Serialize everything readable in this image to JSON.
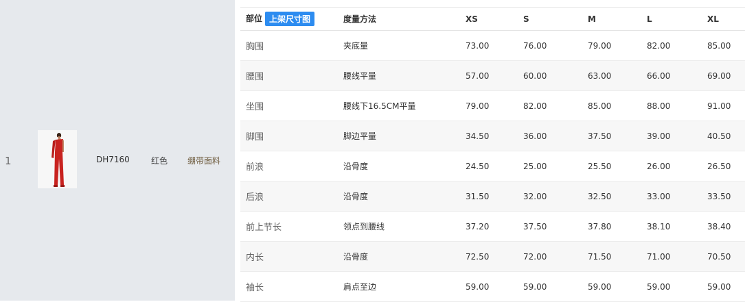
{
  "product": {
    "index": "1",
    "sku": "DH7160",
    "color": "红色",
    "material": "绷带面料",
    "image_colors": {
      "dress": "#c8221f",
      "background": "#f7f7f7"
    }
  },
  "size_table": {
    "header": {
      "part": "部位",
      "badge": "上架尺寸图",
      "method": "度量方法",
      "sizes": [
        "XS",
        "S",
        "M",
        "L",
        "XL"
      ]
    },
    "rows": [
      {
        "part": "胸围",
        "method": "夹底量",
        "values": [
          "73.00",
          "76.00",
          "79.00",
          "82.00",
          "85.00"
        ]
      },
      {
        "part": "腰围",
        "method": "腰线平量",
        "values": [
          "57.00",
          "60.00",
          "63.00",
          "66.00",
          "69.00"
        ]
      },
      {
        "part": "坐围",
        "method": "腰线下16.5CM平量",
        "values": [
          "79.00",
          "82.00",
          "85.00",
          "88.00",
          "91.00"
        ]
      },
      {
        "part": "脚围",
        "method": "脚边平量",
        "values": [
          "34.50",
          "36.00",
          "37.50",
          "39.00",
          "40.50"
        ]
      },
      {
        "part": "前浪",
        "method": "沿骨度",
        "values": [
          "24.50",
          "25.00",
          "25.50",
          "26.00",
          "26.50"
        ]
      },
      {
        "part": "后浪",
        "method": "沿骨度",
        "values": [
          "31.50",
          "32.00",
          "32.50",
          "33.00",
          "33.50"
        ]
      },
      {
        "part": "前上节长",
        "method": "领点到腰线",
        "values": [
          "37.20",
          "37.50",
          "37.80",
          "38.10",
          "38.40"
        ]
      },
      {
        "part": "内长",
        "method": "沿骨度",
        "values": [
          "72.50",
          "72.00",
          "71.50",
          "71.00",
          "70.50"
        ]
      },
      {
        "part": "袖长",
        "method": "肩点至边",
        "values": [
          "59.00",
          "59.00",
          "59.00",
          "59.00",
          "59.00"
        ]
      }
    ]
  },
  "colors": {
    "badge": "#2d8cf0",
    "left_panel": "#e6e9ed"
  }
}
